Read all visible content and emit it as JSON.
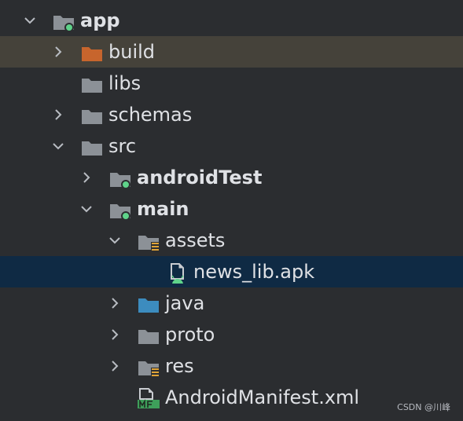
{
  "tree": {
    "app": "app",
    "build": "build",
    "libs": "libs",
    "schemas": "schemas",
    "src": "src",
    "androidTest": "androidTest",
    "main": "main",
    "assets": "assets",
    "news_lib_apk": "news_lib.apk",
    "java": "java",
    "proto": "proto",
    "res": "res",
    "manifest": "AndroidManifest.xml"
  },
  "watermark": "CSDN @川峰",
  "colors": {
    "background": "#2b2d30",
    "build_row_highlight": "#45423a",
    "selected_row": "#0f2a44",
    "folder_gray": "#8c9197",
    "folder_orange": "#c7652d",
    "folder_blue": "#3c8cbf",
    "module_green_dot": "#5fd38a"
  }
}
